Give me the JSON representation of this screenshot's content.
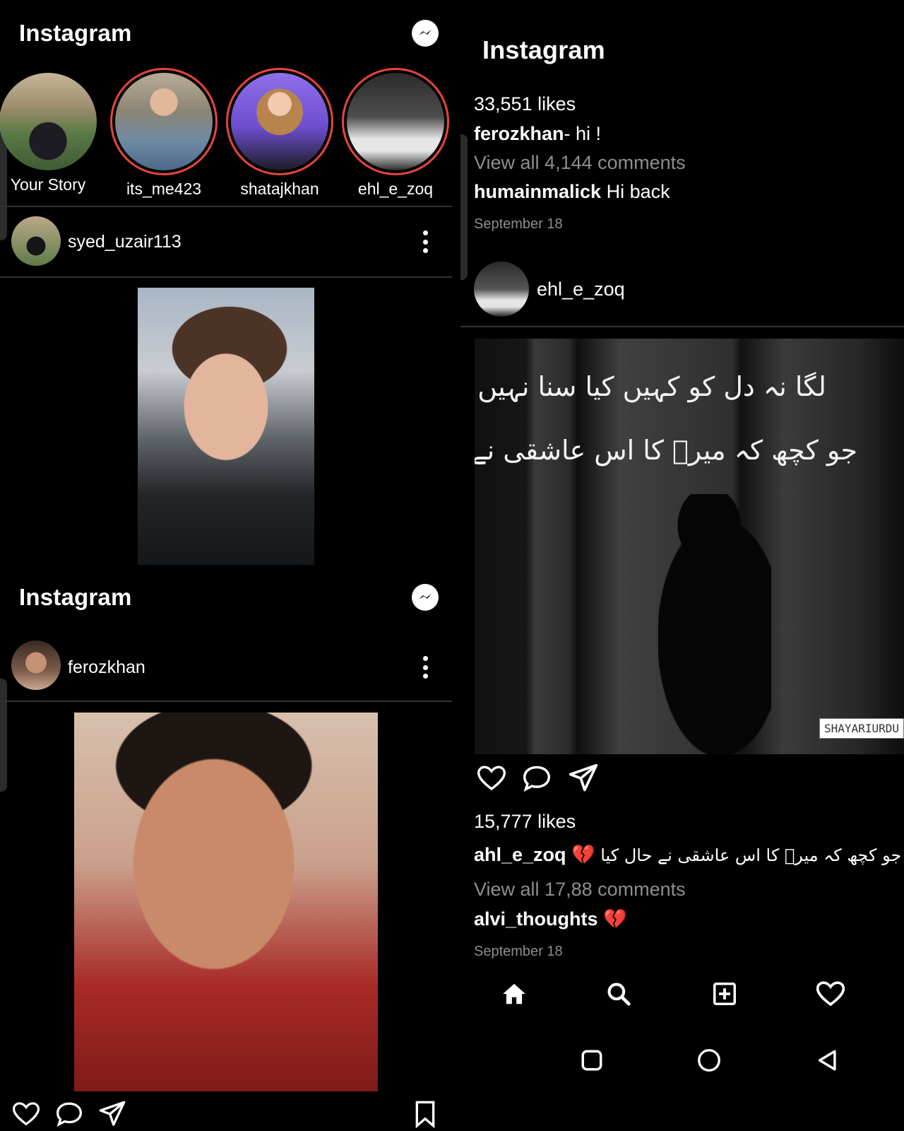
{
  "left": {
    "header1": {
      "title": "Instagram"
    },
    "stories": [
      {
        "label": "Your Story",
        "ring": false,
        "colors": [
          "#3d3a33",
          "#6a6e72"
        ]
      },
      {
        "label": "its_me423",
        "ring": true,
        "colors": [
          "#8d8a80",
          "#4a6c8a"
        ]
      },
      {
        "label": "shatajkhan",
        "ring": true,
        "colors": [
          "#7c5bd6",
          "#c69a72"
        ]
      },
      {
        "label": "ehl_e_zoq",
        "ring": true,
        "colors": [
          "#2a2a2a",
          "#d8d8d8"
        ]
      }
    ],
    "post1": {
      "username": "syed_uzair113"
    },
    "header2": {
      "title": "Instagram"
    },
    "post2": {
      "username": "ferozkhan"
    }
  },
  "right": {
    "header": {
      "title": "Instagram"
    },
    "prev_post": {
      "likes": "33,551 likes",
      "caption_user": "ferozkhan",
      "caption_text": "- hi !",
      "view_comments": "View all 4,144 comments",
      "comment_user": "humainmalick",
      "comment_text": "Hi back",
      "date": "September 18"
    },
    "post": {
      "username": "ehl_e_zoq",
      "image_line1": "لگا نہ دل کو کہیں کیا سنا نہیں تو نے",
      "image_line2": "جو کچھ کہ میرؔ کا اس عاشقی نے حال کیا",
      "watermark": "SHAYARIURDU",
      "likes": "15,777 likes",
      "caption_user": "ahl_e_zoq",
      "caption_emoji": "💔",
      "caption_text": "جو کچھ کہ میرؔ کا اس عاشقی نے حال کیا",
      "view_comments": "View all 17,88 comments",
      "comment_user": "alvi_thoughts",
      "comment_emoji": "💔",
      "date": "September 18"
    },
    "nav": [
      "home-icon",
      "search-icon",
      "add-post-icon",
      "activity-heart-icon"
    ],
    "system_nav": [
      "recents-square-icon",
      "home-circle-icon",
      "back-triangle-icon"
    ]
  },
  "colors": {
    "story_ring": "#e8453c",
    "background": "#000000",
    "muted_text": "#8e8e8e",
    "heart_red": "#d8263a"
  }
}
